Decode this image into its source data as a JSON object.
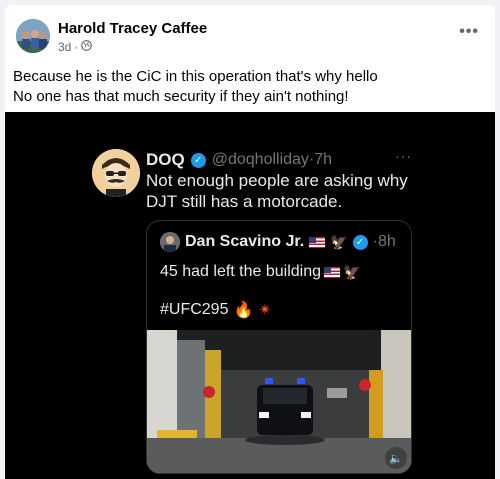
{
  "post": {
    "author": "Harold Tracey Caffee",
    "timestamp": "3d",
    "separator": "·",
    "audience_icon": "globe-icon",
    "more_label": "•••",
    "caption_line1": "Because he is the CiC in this operation that's why hello",
    "caption_line2": "No one has that much security if they ain't nothing!"
  },
  "tweet": {
    "name": "DOQ",
    "handle": "@doqholliday",
    "separator": "·",
    "time": "7h",
    "more_label": "···",
    "text_line1": "Not enough people are asking why",
    "text_line2": "DJT still has a motorcade.",
    "quote": {
      "name": "Dan Scavino Jr.",
      "separator": "·",
      "time": "8h",
      "text_line1": "45 had left the building",
      "hashtag": "#UFC295",
      "fire_emoji": "🔥",
      "spark_emoji": "✴",
      "eagle_emoji": "🦅",
      "volume_icon": "🔈"
    }
  },
  "colors": {
    "facebook_text": "#050505",
    "facebook_meta": "#65676b",
    "twitter_bg": "#000000",
    "twitter_text": "#e7e9ea",
    "twitter_muted": "#71767b",
    "verified_blue": "#1d9bf0"
  }
}
